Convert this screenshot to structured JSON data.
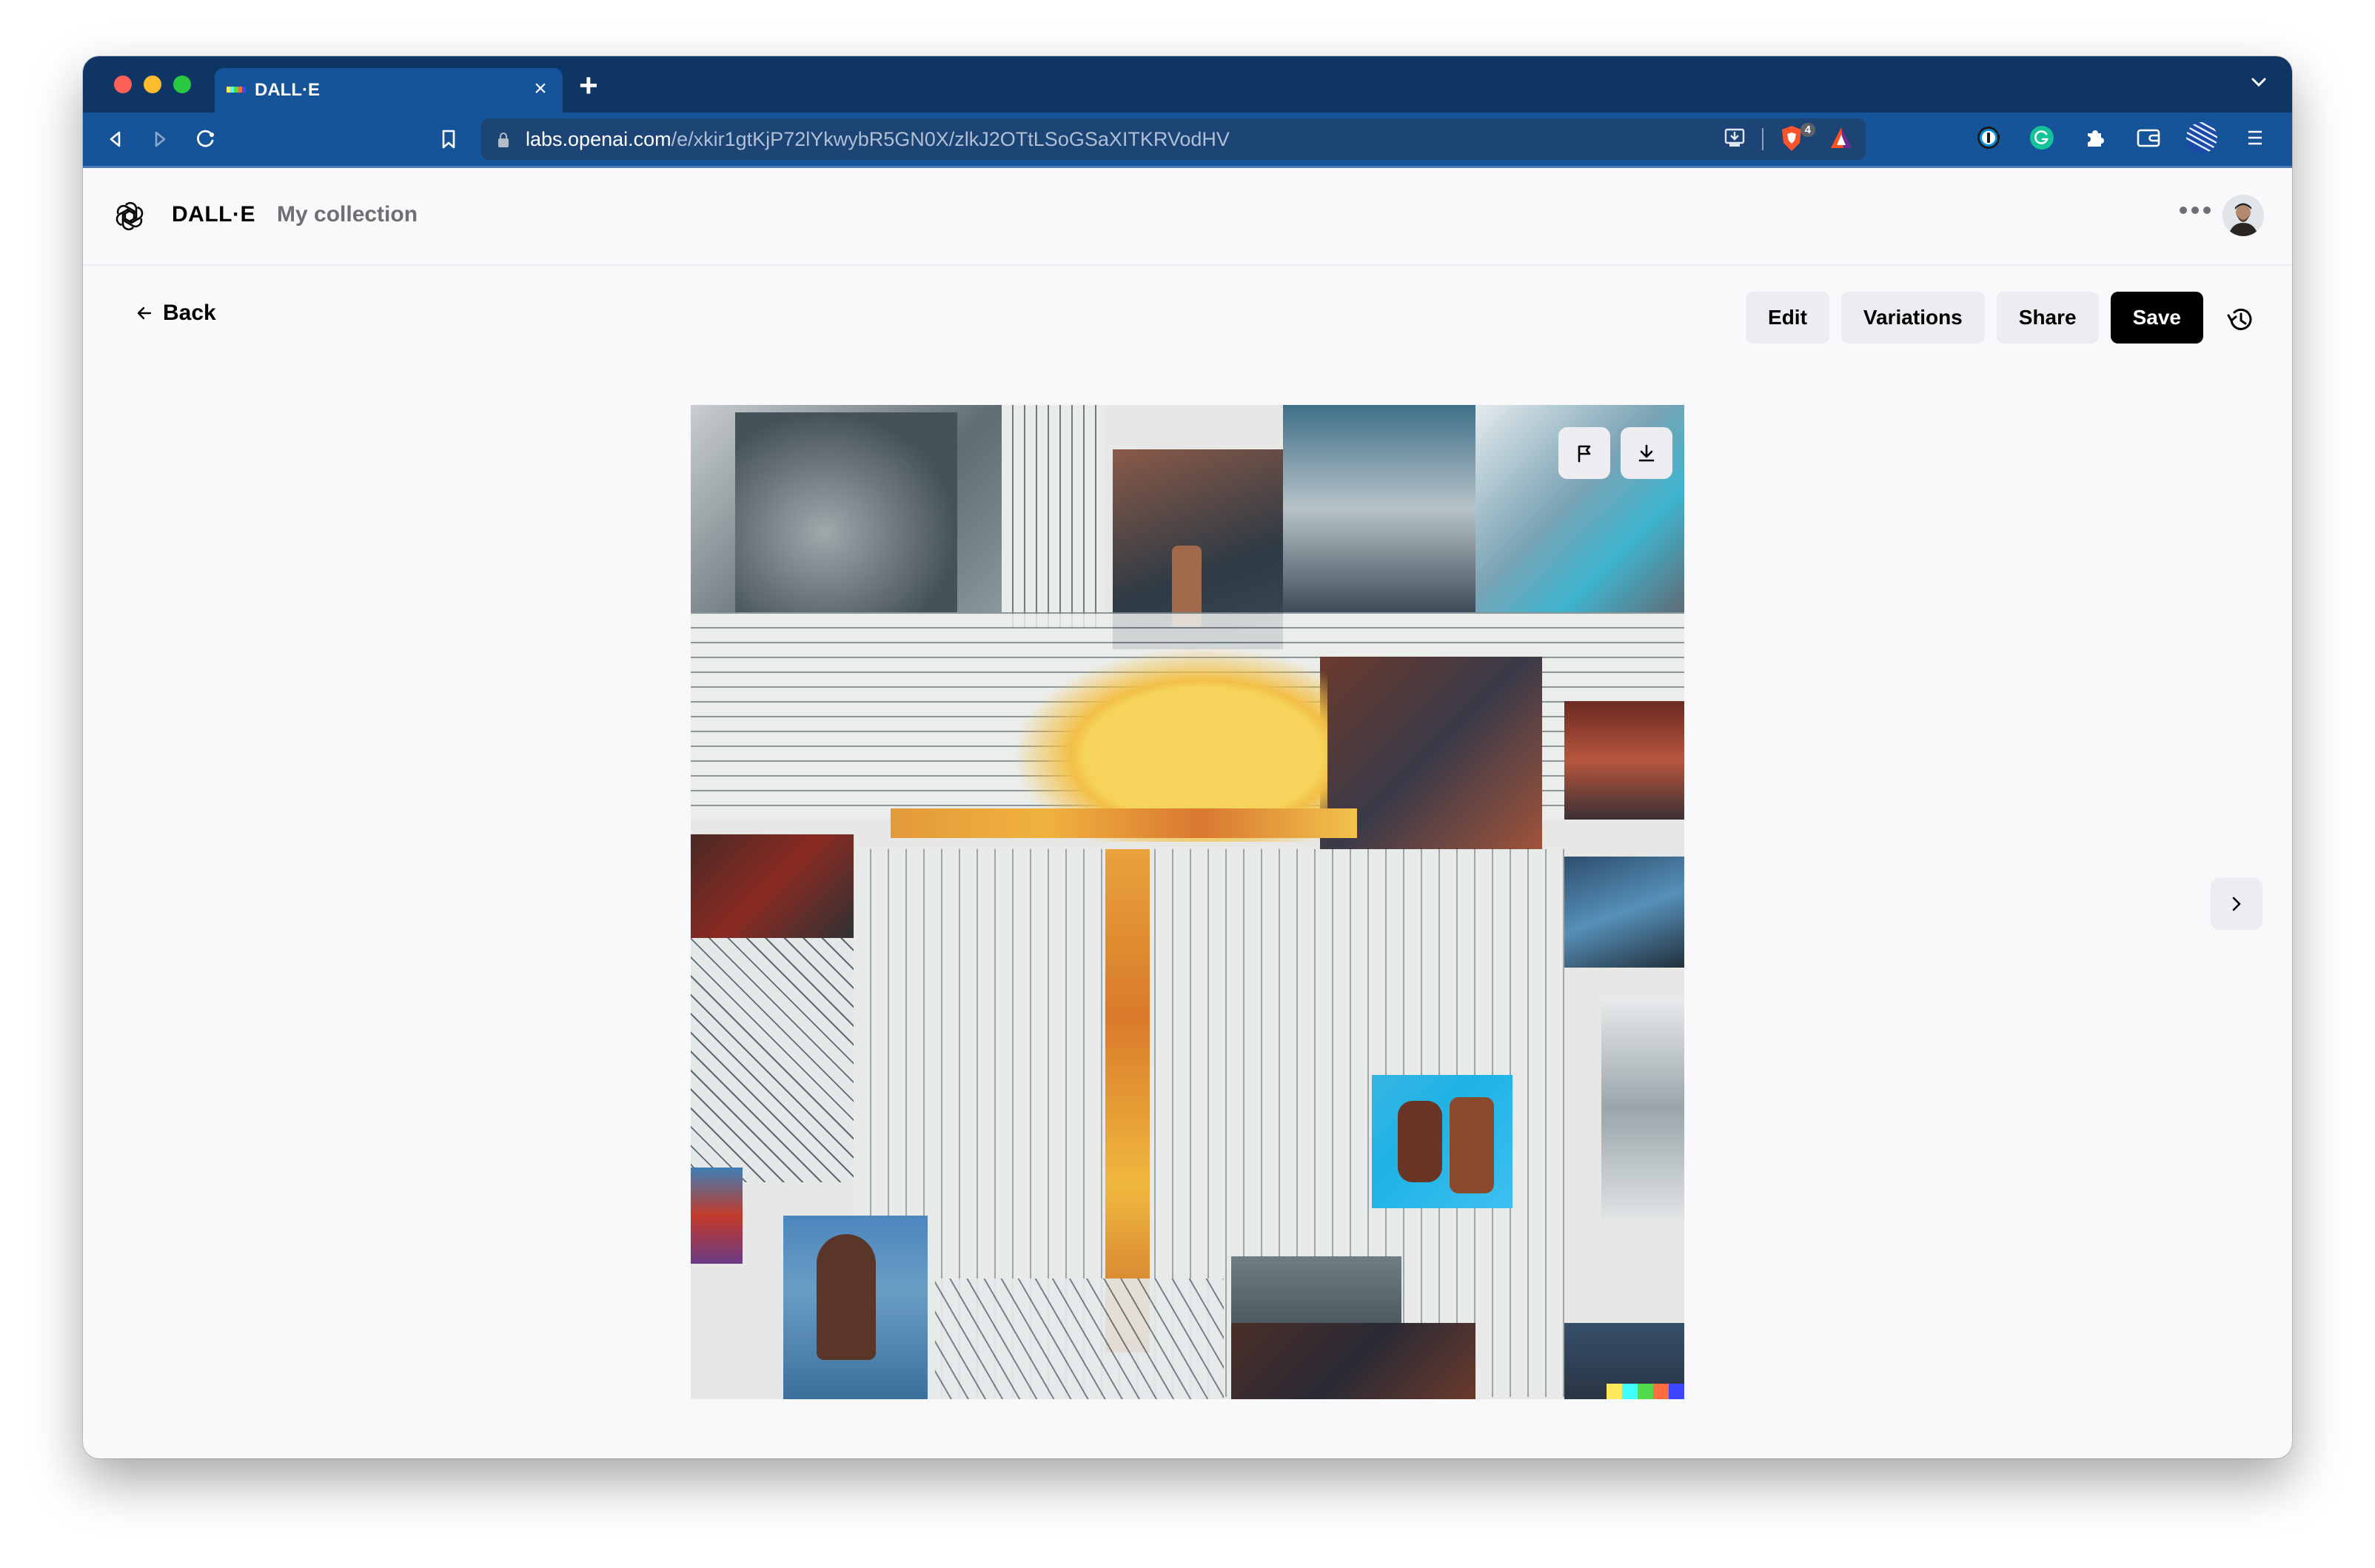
{
  "browser": {
    "tab": {
      "title": "DALL·E",
      "favicon_colors": [
        "#ffe85c",
        "#42ffff",
        "#51da4c",
        "#ff6e3c",
        "#3c46ff"
      ],
      "close_label": "×"
    },
    "new_tab_label": "+",
    "url": {
      "host": "labs.openai.com",
      "path": "/e/xkir1gtKjP72lYkwybR5GN0X/zlkJ2OTtLSoGSaXITKRVodHV"
    },
    "brave_shields_count": "4",
    "extensions": [
      "1password-icon",
      "grammarly-icon",
      "puzzle-extensions-icon",
      "wallet-icon",
      "profile-striped-icon",
      "menu-icon"
    ]
  },
  "header": {
    "brand": "DALL·E",
    "nav_link": "My collection"
  },
  "toolbar": {
    "back_label": "Back",
    "edit_label": "Edit",
    "variations_label": "Variations",
    "share_label": "Share",
    "save_label": "Save"
  },
  "image": {
    "alt": "Generated collage of industrial scaffolding with yellow hard hat",
    "signature_colors": [
      "#ffe85c",
      "#42ffff",
      "#51da4c",
      "#ff6e3c",
      "#3c46ff"
    ]
  }
}
